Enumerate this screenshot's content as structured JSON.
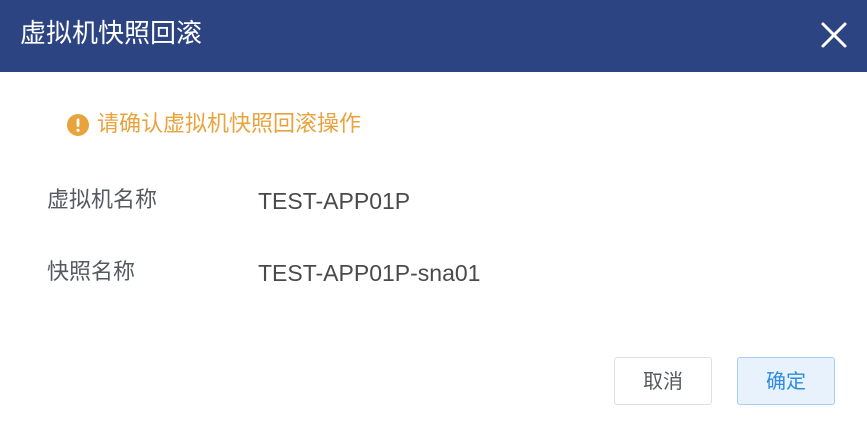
{
  "dialog": {
    "title": "虚拟机快照回滚",
    "close_icon": "close-icon"
  },
  "warning": {
    "icon": "exclamation-circle-icon",
    "text": "请确认虚拟机快照回滚操作",
    "color": "#e8a33d"
  },
  "fields": {
    "vm_name_label": "虚拟机名称",
    "vm_name_value": "TEST-APP01P",
    "snapshot_name_label": "快照名称",
    "snapshot_name_value": "TEST-APP01P-sna01"
  },
  "buttons": {
    "cancel_label": "取消",
    "ok_label": "确定"
  },
  "colors": {
    "header_bg": "#2d4483",
    "primary": "#2e8be0"
  }
}
